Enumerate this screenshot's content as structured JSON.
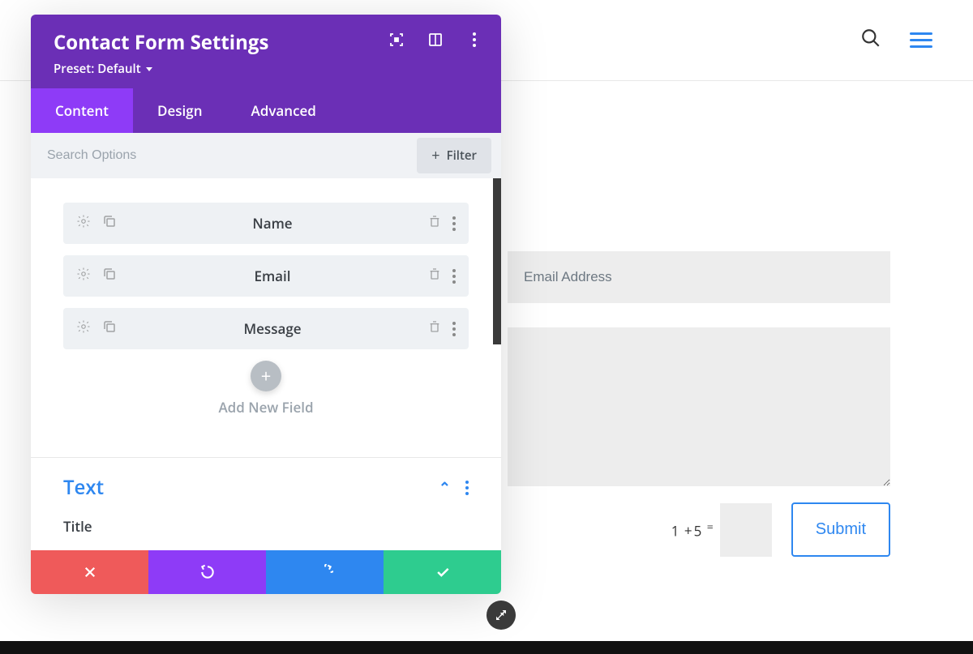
{
  "top_nav": {},
  "panel": {
    "title": "Contact Form Settings",
    "preset_label": "Preset: Default",
    "tabs": [
      {
        "label": "Content",
        "active": true
      },
      {
        "label": "Design",
        "active": false
      },
      {
        "label": "Advanced",
        "active": false
      }
    ],
    "search_placeholder": "Search Options",
    "filter_label": "Filter",
    "fields": [
      {
        "label": "Name"
      },
      {
        "label": "Email"
      },
      {
        "label": "Message"
      }
    ],
    "add_new_label": "Add New Field",
    "text_section": {
      "heading": "Text",
      "title_label": "Title"
    }
  },
  "preview_form": {
    "email_placeholder": "Email Address",
    "captcha_a": "1",
    "captcha_op": "+",
    "captcha_b": "5",
    "captcha_eq": "=",
    "submit_label": "Submit"
  }
}
